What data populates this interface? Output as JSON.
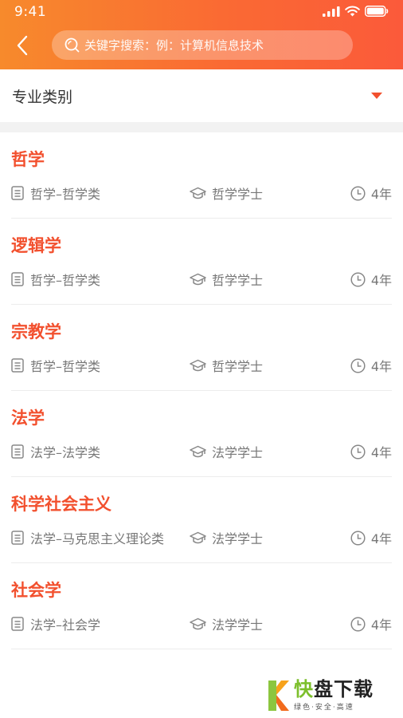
{
  "status_bar": {
    "time": "9:41"
  },
  "search": {
    "placeholder": "关键字搜索：例：计算机信息技术"
  },
  "filter": {
    "label": "专业类别"
  },
  "majors": [
    {
      "title": "哲学",
      "category": "哲学–哲学类",
      "degree": "哲学学士",
      "years": "4年"
    },
    {
      "title": "逻辑学",
      "category": "哲学–哲学类",
      "degree": "哲学学士",
      "years": "4年"
    },
    {
      "title": "宗教学",
      "category": "哲学–哲学类",
      "degree": "哲学学士",
      "years": "4年"
    },
    {
      "title": "法学",
      "category": "法学–法学类",
      "degree": "法学学士",
      "years": "4年"
    },
    {
      "title": "科学社会主义",
      "category": "法学–马克思主义理论类",
      "degree": "法学学士",
      "years": "4年"
    },
    {
      "title": "社会学",
      "category": "法学–社会学",
      "degree": "法学学士",
      "years": "4年"
    }
  ],
  "watermark": {
    "kuai": "快",
    "rest": "盘下载",
    "sub": "绿色·安全·高速"
  },
  "icons": {
    "back": "chevron-left-icon",
    "search": "search-icon",
    "dropdown": "caret-down-icon",
    "category": "document-icon",
    "degree": "graduation-cap-icon",
    "years": "clock-icon"
  },
  "colors": {
    "accent": "#f2502e",
    "header_start": "#f78a2c",
    "header_end": "#fb5a3a",
    "watermark_green": "#7cbf2b"
  }
}
